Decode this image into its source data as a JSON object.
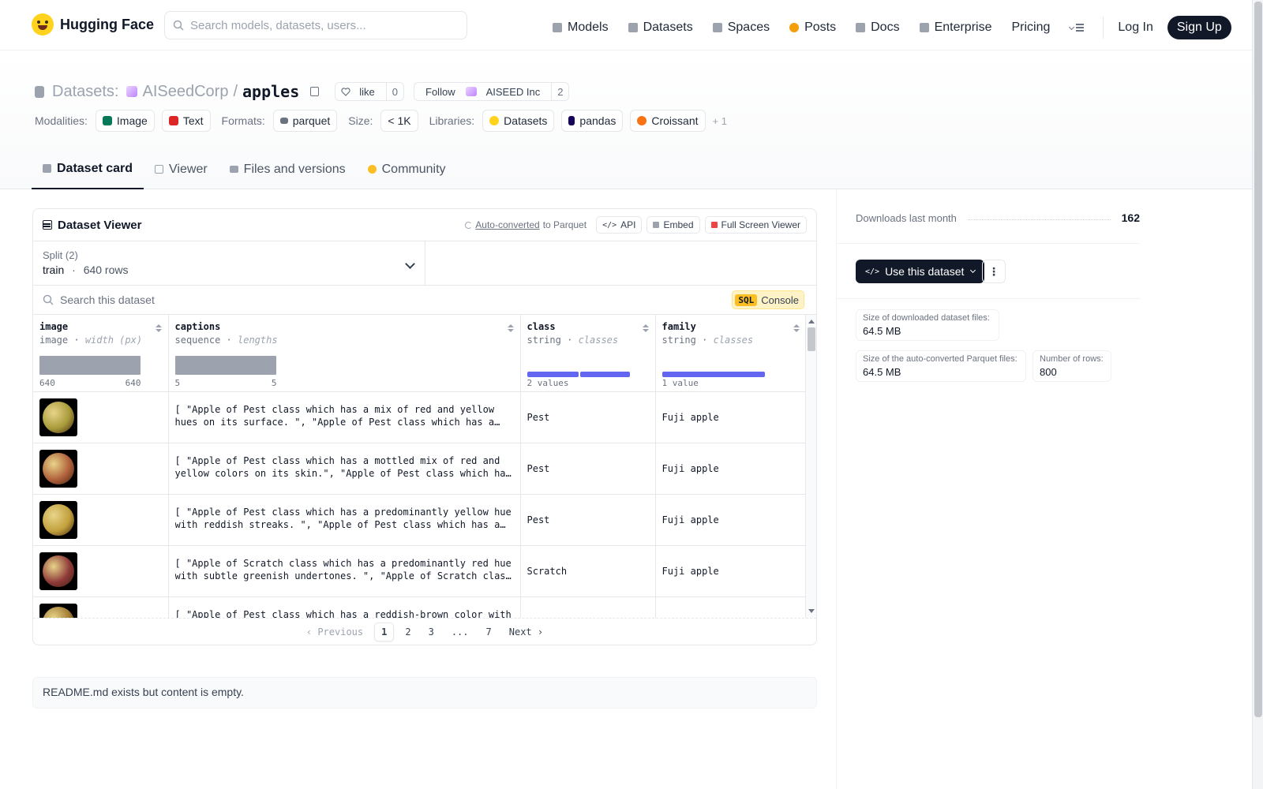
{
  "brand": {
    "name": "Hugging Face"
  },
  "nav": {
    "search_placeholder": "Search models, datasets, users...",
    "links": [
      "Models",
      "Datasets",
      "Spaces",
      "Posts",
      "Docs",
      "Enterprise",
      "Pricing"
    ],
    "login": "Log In",
    "signup": "Sign Up"
  },
  "dataset": {
    "crumb": "Datasets:",
    "owner": "AISeedCorp",
    "slash": "/",
    "name": "apples",
    "like_label": "like",
    "like_count": "0",
    "follow_label": "Follow",
    "follow_org": "AISEED Inc",
    "follow_count": "2"
  },
  "tags": {
    "modalities_label": "Modalities:",
    "modalities": [
      "Image",
      "Text"
    ],
    "formats_label": "Formats:",
    "formats": [
      "parquet"
    ],
    "size_label": "Size:",
    "size": "< 1K",
    "libraries_label": "Libraries:",
    "libraries": [
      "Datasets",
      "pandas",
      "Croissant"
    ],
    "more": "+ 1"
  },
  "tabs": [
    "Dataset card",
    "Viewer",
    "Files and versions",
    "Community"
  ],
  "viewer": {
    "title": "Dataset Viewer",
    "auto_converted": "Auto-converted",
    "to_parquet": "to Parquet",
    "api": "API",
    "embed": "Embed",
    "fullscreen": "Full Screen Viewer",
    "split_label": "Split (2)",
    "split_name": "train",
    "split_sep": "·",
    "split_rows": "640 rows",
    "search_placeholder": "Search this dataset",
    "sql": "SQL",
    "console": "Console",
    "columns": [
      {
        "name": "image",
        "type": "image",
        "sub": "width (px)",
        "min": "640",
        "max": "640"
      },
      {
        "name": "captions",
        "type": "sequence",
        "sub": "lengths",
        "min": "5",
        "max": "5"
      },
      {
        "name": "class",
        "type": "string",
        "sub": "classes",
        "note": "2 values"
      },
      {
        "name": "family",
        "type": "string",
        "sub": "classes",
        "note": "1 value"
      }
    ],
    "type_sep": "·",
    "rows": [
      {
        "caption": "[ \"Apple of Pest class which has a mix of red and yellow hues on its surface. \", \"Apple of Pest class which has a smooth and glossy skin.\" ]",
        "class": "Pest",
        "family": "Fuji apple",
        "color": "#a89a3a"
      },
      {
        "caption": "[ \"Apple of Pest class which has a mottled mix of red and yellow colors on its skin.\", \"Apple of Pest class which has a round shape.\" ]",
        "class": "Pest",
        "family": "Fuji apple",
        "color": "#b0603a"
      },
      {
        "caption": "[ \"Apple of Pest class which has a predominantly yellow hue with reddish streaks. \", \"Apple of Pest class which has a blemish.\" ]",
        "class": "Pest",
        "family": "Fuji apple",
        "color": "#c2a13c"
      },
      {
        "caption": "[ \"Apple of Scratch class which has a predominantly red hue with subtle greenish undertones. \", \"Apple of Scratch class which has marks.\" ]",
        "class": "Scratch",
        "family": "Fuji apple",
        "color": "#8e3a38"
      },
      {
        "caption": "[ \"Apple of Pest class which has a reddish-brown color with yellow patches.\" ]",
        "class": "",
        "family": "",
        "color": "#a27a34"
      }
    ],
    "pager": {
      "prev": "Previous",
      "pages": [
        "1",
        "2",
        "3",
        "...",
        "7"
      ],
      "next": "Next"
    }
  },
  "readme": "README.md exists but content is empty.",
  "sidebar": {
    "downloads_label": "Downloads last month",
    "downloads_value": "162",
    "use_dataset": "Use this dataset",
    "kebab": "⋮",
    "size_downloaded_label": "Size of downloaded dataset files:",
    "size_downloaded_value": "64.5 MB",
    "size_parquet_label": "Size of the auto-converted Parquet files:",
    "size_parquet_value": "64.5 MB",
    "num_rows_label": "Number of rows:",
    "num_rows_value": "800"
  },
  "colors": {
    "accent": "#6366f1",
    "dark": "#111827",
    "brand": "#ffd21e",
    "sql": "#fbbf24"
  }
}
